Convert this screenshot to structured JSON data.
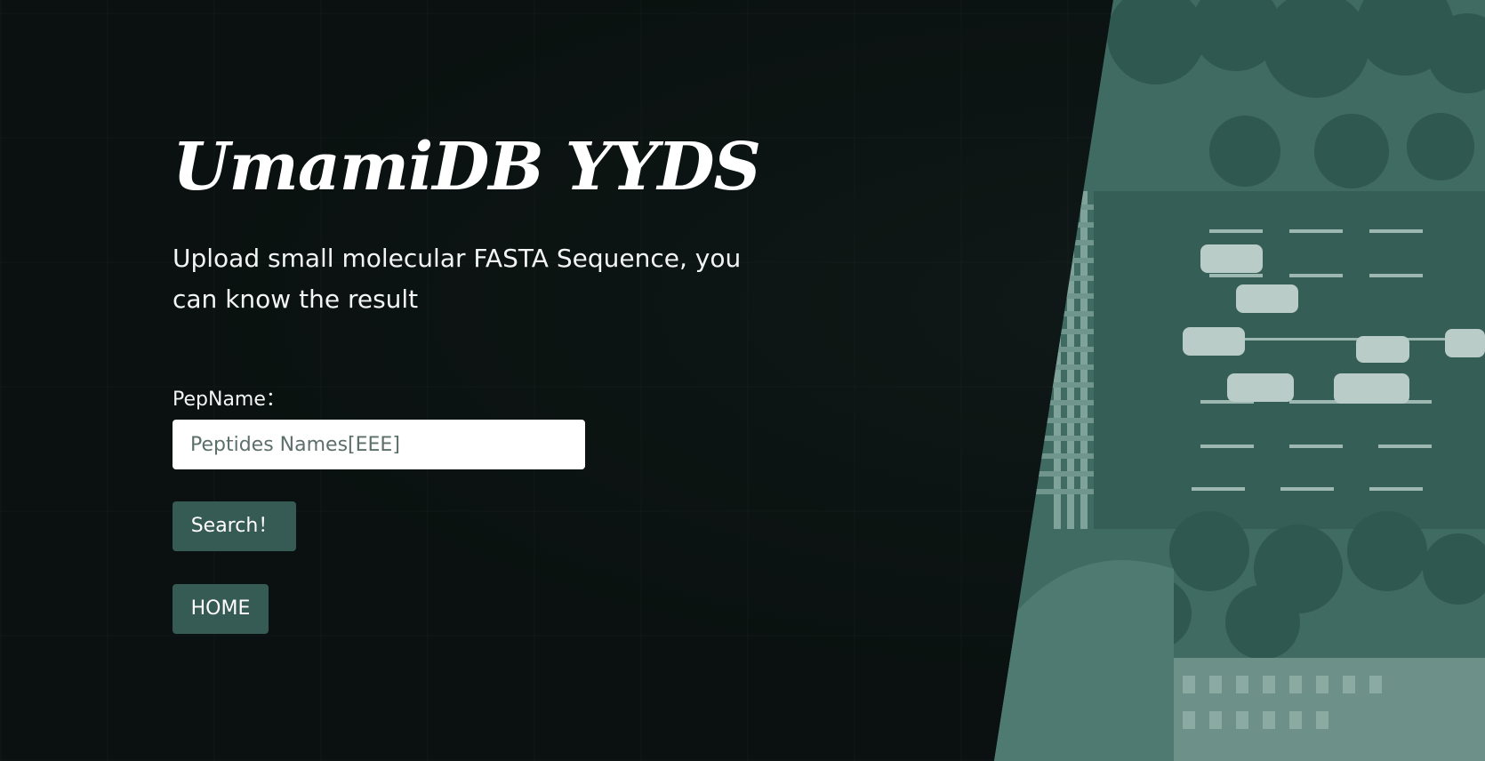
{
  "hero": {
    "title": "UmamiDB YYDS",
    "subtitle": "Upload small molecular FASTA Sequence, you can know the result"
  },
  "form": {
    "pepname_label": "PepName：",
    "pepname_placeholder": "Peptides Names[EEE]",
    "pepname_value": "",
    "search_label": "Search！",
    "home_label": "HOME"
  },
  "colors": {
    "background": "#0a1110",
    "aerial_tint": "#3f6b62",
    "button": "#365a54",
    "text": "#ffffff"
  },
  "background_image": "aerial-city-intersection"
}
